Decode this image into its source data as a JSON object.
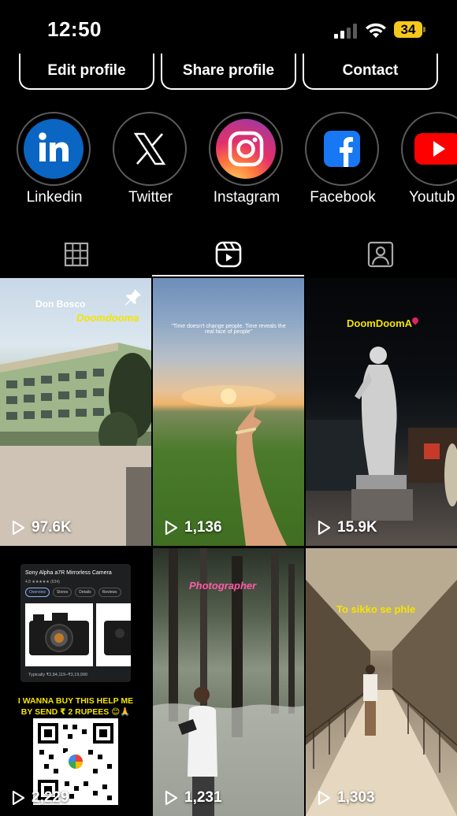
{
  "status": {
    "time": "12:50",
    "battery": "34"
  },
  "buttons": {
    "edit": "Edit profile",
    "share": "Share profile",
    "contact": "Contact"
  },
  "highlights": [
    {
      "label": "Linkedin",
      "icon": "linkedin-icon"
    },
    {
      "label": "Twitter",
      "icon": "x-icon"
    },
    {
      "label": "Instagram",
      "icon": "instagram-icon"
    },
    {
      "label": "Facebook",
      "icon": "facebook-icon"
    },
    {
      "label": "Youtub",
      "icon": "youtube-icon"
    }
  ],
  "tabs": [
    "grid-icon",
    "reels-icon",
    "tagged-icon"
  ],
  "active_tab": "reels",
  "posts": [
    {
      "views": "97.6K",
      "title_a": "Don Bosco",
      "title_b": "Doomdooma",
      "pinned": true
    },
    {
      "views": "1,136",
      "quote": "\"Time doesn't change people. Time reveals the real face of people\""
    },
    {
      "views": "15.9K",
      "title": "DoomDoomA"
    },
    {
      "views": "2,229",
      "product": "Sony Alpha a7R Mirrorless Camera",
      "rating": "4.8 ★★★★★ (634)",
      "chips": [
        "Overview",
        "Stores",
        "Details",
        "Reviews"
      ],
      "price": "Typically ₹2,84,119–₹3,19,990",
      "caption": "I WANNA BUY THIS HELP ME BY SEND ₹ 2 RUPEES 😊🙏"
    },
    {
      "views": "1,231",
      "title": "Photographer"
    },
    {
      "views": "1,303",
      "title": "To sikko se phle"
    }
  ],
  "colors": {
    "background": "#000000",
    "battery": "#f4c81e",
    "linkedin": "#0a66c2",
    "facebook": "#1877f2",
    "youtube": "#ff0000"
  }
}
